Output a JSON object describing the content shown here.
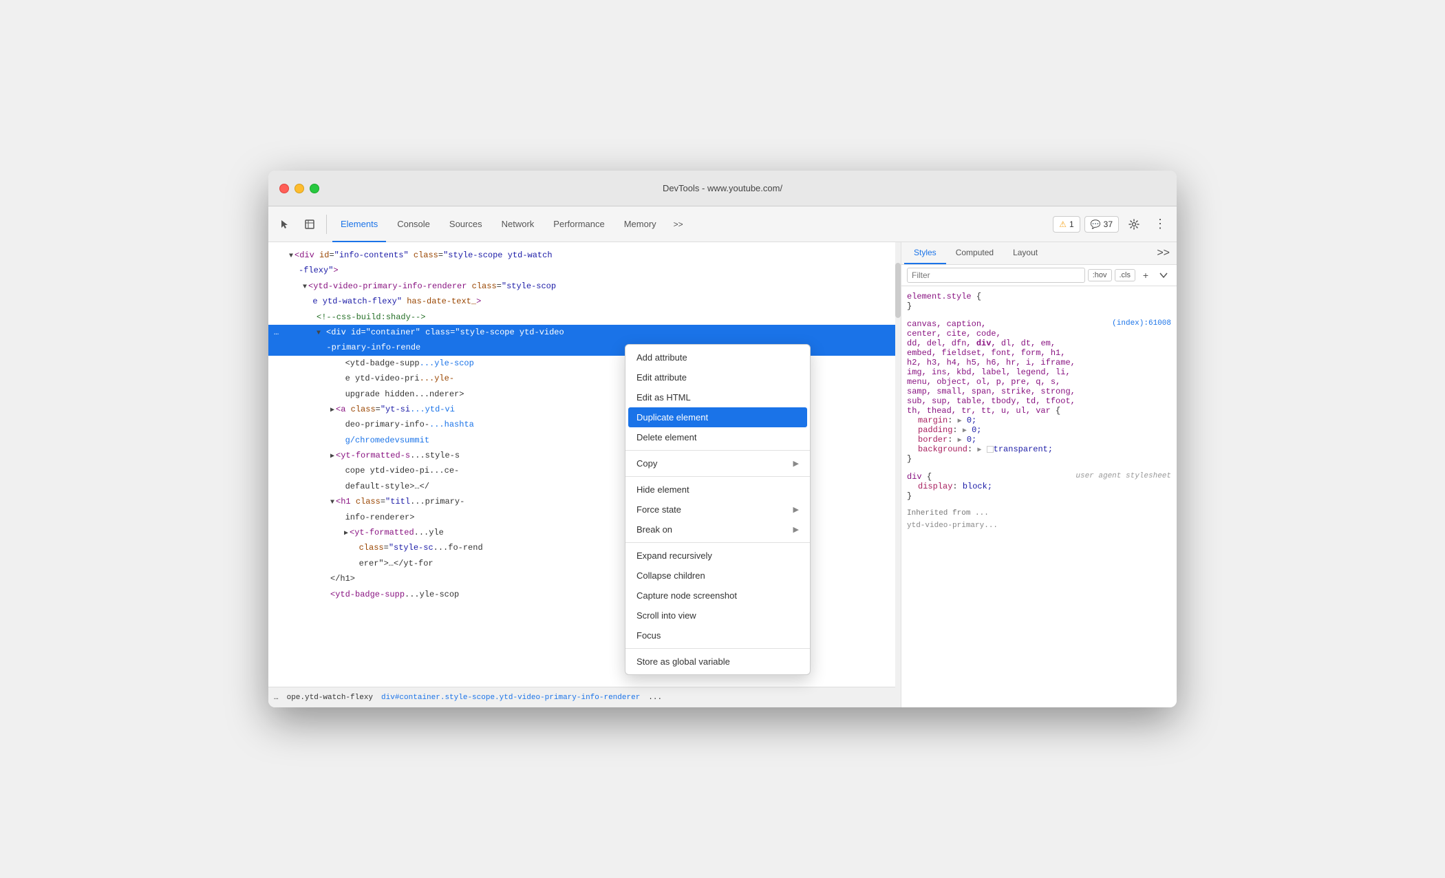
{
  "window": {
    "title": "DevTools - www.youtube.com/"
  },
  "toolbar": {
    "tabs": [
      {
        "id": "elements",
        "label": "Elements",
        "active": true
      },
      {
        "id": "console",
        "label": "Console",
        "active": false
      },
      {
        "id": "sources",
        "label": "Sources",
        "active": false
      },
      {
        "id": "network",
        "label": "Network",
        "active": false
      },
      {
        "id": "performance",
        "label": "Performance",
        "active": false
      },
      {
        "id": "memory",
        "label": "Memory",
        "active": false
      }
    ],
    "more_tabs_label": ">>",
    "warning_count": "1",
    "info_count": "37"
  },
  "dom_panel": {
    "lines": [
      {
        "id": 1,
        "indent": 2,
        "html": "▼ &lt;div id=\"info-contents\" class=\"style-scope ytd-watch",
        "selected": false
      },
      {
        "id": 2,
        "indent": 2,
        "html": "   -flexy\"&gt;",
        "selected": false
      },
      {
        "id": 3,
        "indent": 3,
        "html": "▼ &lt;ytd-video-primary-info-renderer class=\"style-scop",
        "selected": false
      },
      {
        "id": 4,
        "indent": 3,
        "html": "  e ytd-watch-flexy\" has-date-text_&gt;",
        "selected": false
      },
      {
        "id": 5,
        "indent": 4,
        "html": "&lt;!--css-build:shady--&gt;",
        "selected": false
      },
      {
        "id": 6,
        "indent": 4,
        "html": "▼ &lt;div id=\"container\" class=\"style-scope ytd-video",
        "selected": true
      },
      {
        "id": 7,
        "indent": 4,
        "html": "   -primary-info-rende",
        "selected": true
      },
      {
        "id": 8,
        "indent": 5,
        "html": "&lt;ytd-badge-supp",
        "selected": false
      },
      {
        "id": 9,
        "indent": 5,
        "html": "e ytd-video-pri",
        "selected": false
      },
      {
        "id": 10,
        "indent": 5,
        "html": "upgrade hidden",
        "selected": false
      },
      {
        "id": 11,
        "indent": 5,
        "html": "▶ &lt;a class=\"yt-si",
        "selected": false
      },
      {
        "id": 12,
        "indent": 5,
        "html": "deo-primary-info-",
        "selected": false
      },
      {
        "id": 13,
        "indent": 5,
        "html": "g/chromedevsummit",
        "selected": false
      },
      {
        "id": 14,
        "indent": 5,
        "html": "▶ &lt;yt-formatted-s",
        "selected": false
      },
      {
        "id": 15,
        "indent": 5,
        "html": "cope ytd-video-pi",
        "selected": false
      },
      {
        "id": 16,
        "indent": 5,
        "html": "default-style>…&lt;/",
        "selected": false
      },
      {
        "id": 17,
        "indent": 5,
        "html": "▼ &lt;h1 class=\"titl",
        "selected": false
      },
      {
        "id": 18,
        "indent": 5,
        "html": "info-renderer&gt;",
        "selected": false
      },
      {
        "id": 19,
        "indent": 6,
        "html": "▶ &lt;yt-formatted",
        "selected": false
      },
      {
        "id": 20,
        "indent": 6,
        "html": "class=\"style-sc",
        "selected": false
      },
      {
        "id": 21,
        "indent": 6,
        "html": "erer\"&gt;…&lt;/yt-for",
        "selected": false
      },
      {
        "id": 22,
        "indent": 5,
        "html": "&lt;/h1&gt;",
        "selected": false
      },
      {
        "id": 23,
        "indent": 5,
        "html": "&lt;ytd-badge-supp",
        "selected": false
      }
    ],
    "scrollbar": true
  },
  "status_bar": {
    "items": [
      {
        "id": 1,
        "text": "...",
        "type": "dots"
      },
      {
        "id": 2,
        "text": "ope.ytd-watch-flexy",
        "type": "breadcrumb"
      },
      {
        "id": 3,
        "text": "div#container.style-scope.ytd-video-primary-info-renderer",
        "type": "current"
      },
      {
        "id": 4,
        "text": "...",
        "type": "dots"
      }
    ]
  },
  "context_menu": {
    "items": [
      {
        "id": "add-attr",
        "label": "Add attribute",
        "active": false,
        "hasSubmenu": false
      },
      {
        "id": "edit-attr",
        "label": "Edit attribute",
        "active": false,
        "hasSubmenu": false
      },
      {
        "id": "edit-html",
        "label": "Edit as HTML",
        "active": false,
        "hasSubmenu": false
      },
      {
        "id": "duplicate",
        "label": "Duplicate element",
        "active": true,
        "hasSubmenu": false
      },
      {
        "id": "delete",
        "label": "Delete element",
        "active": false,
        "hasSubmenu": false
      },
      {
        "id": "divider1",
        "type": "divider"
      },
      {
        "id": "copy",
        "label": "Copy",
        "active": false,
        "hasSubmenu": true
      },
      {
        "id": "divider2",
        "type": "divider"
      },
      {
        "id": "hide",
        "label": "Hide element",
        "active": false,
        "hasSubmenu": false
      },
      {
        "id": "force-state",
        "label": "Force state",
        "active": false,
        "hasSubmenu": true
      },
      {
        "id": "break-on",
        "label": "Break on",
        "active": false,
        "hasSubmenu": true
      },
      {
        "id": "divider3",
        "type": "divider"
      },
      {
        "id": "expand",
        "label": "Expand recursively",
        "active": false,
        "hasSubmenu": false
      },
      {
        "id": "collapse",
        "label": "Collapse children",
        "active": false,
        "hasSubmenu": false
      },
      {
        "id": "screenshot",
        "label": "Capture node screenshot",
        "active": false,
        "hasSubmenu": false
      },
      {
        "id": "scroll",
        "label": "Scroll into view",
        "active": false,
        "hasSubmenu": false
      },
      {
        "id": "focus",
        "label": "Focus",
        "active": false,
        "hasSubmenu": false
      },
      {
        "id": "divider4",
        "type": "divider"
      },
      {
        "id": "store-global",
        "label": "Store as global variable",
        "active": false,
        "hasSubmenu": false
      }
    ]
  },
  "styles_panel": {
    "tabs": [
      {
        "id": "styles",
        "label": "Styles",
        "active": true
      },
      {
        "id": "computed",
        "label": "Computed",
        "active": false
      },
      {
        "id": "layout",
        "label": "Layout",
        "active": false
      }
    ],
    "filter": {
      "placeholder": "Filter",
      "hov_label": ":hov",
      "cls_label": ".cls"
    },
    "css_blocks": [
      {
        "id": "element-style",
        "selector": "element.style {",
        "close": "}",
        "properties": []
      },
      {
        "id": "index-61008",
        "selector": "canvas, caption,",
        "selector2": "center, cite, code,",
        "selector3": "dd, del, dfn, div, dl, dt, em,",
        "selector4": "embed, fieldset, font, form, h1,",
        "selector5": "h2, h3, h4, h5, h6, hr, i, iframe,",
        "selector6": "img, ins, kbd, label, legend, li,",
        "selector7": "menu, object, ol, p, pre, q, s,",
        "selector8": "samp, small, span, strike, strong,",
        "selector9": "sub, sup, table, tbody, td, tfoot,",
        "selector10": "th, thead, tr, tt, u, ul, var {",
        "source": "(index):61008",
        "properties": [
          {
            "name": "margin",
            "value": "▶ 0;"
          },
          {
            "name": "padding",
            "value": "▶ 0;"
          },
          {
            "name": "border",
            "value": "▶ 0;"
          },
          {
            "name": "background",
            "value": "▶ □transparent;"
          }
        ],
        "close": "}"
      },
      {
        "id": "div-user-agent",
        "selector": "div {",
        "source_label": "user agent stylesheet",
        "properties": [
          {
            "name": "display",
            "value": "block;"
          }
        ],
        "close": "}"
      }
    ],
    "inherited_label": "Inherited from ...",
    "inherited_item": "ytd-video-primary..."
  }
}
